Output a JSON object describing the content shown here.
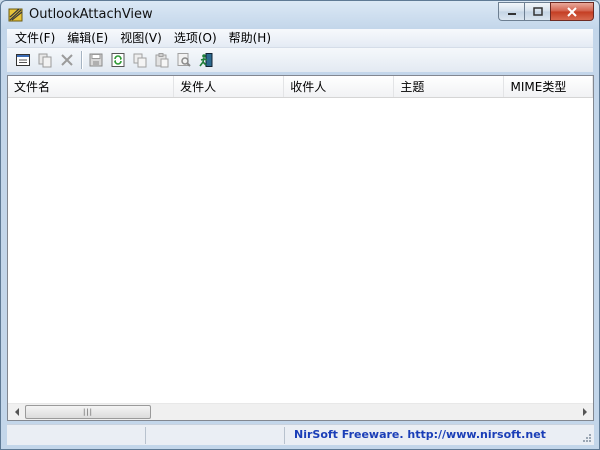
{
  "window": {
    "title": "OutlookAttachView"
  },
  "menu": [
    "文件(F)",
    "编辑(E)",
    "视图(V)",
    "选项(O)",
    "帮助(H)"
  ],
  "toolbar": [
    "properties-icon",
    "copy-selected-icon",
    "delete-icon",
    "save-icon",
    "refresh-icon",
    "copy-icon",
    "paste-icon",
    "find-icon",
    "exit-icon"
  ],
  "columns": [
    "文件名",
    "发件人",
    "收件人",
    "主题",
    "MIME类型"
  ],
  "status": {
    "link": "NirSoft Freeware.  http://www.nirsoft.net"
  },
  "colors": {
    "link": "#1a3eb7",
    "close_button": "#c43d22"
  }
}
